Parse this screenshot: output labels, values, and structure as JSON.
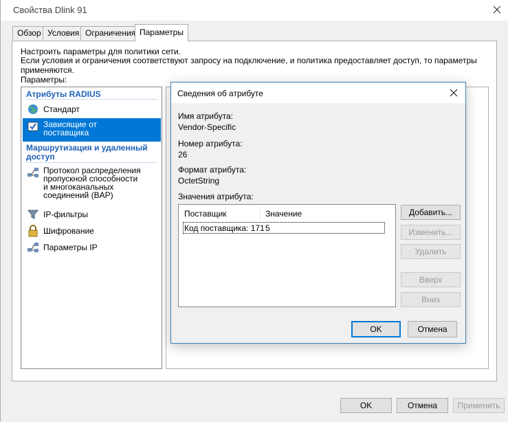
{
  "window": {
    "title": "Свойства Dlink 91",
    "tabs": [
      "Обзор",
      "Условия",
      "Ограничения",
      "Параметры"
    ],
    "description_line1": "Настроить параметры для политики сети.",
    "description_line2": "Если условия и ограничения соответствуют запросу на подключение, и политика предоставляет доступ, то параметры применяются.",
    "params_label": "Параметры:",
    "buttons": {
      "ok": "OK",
      "cancel": "Отмена",
      "apply": "Применить"
    }
  },
  "nav": {
    "radius_header": "Атрибуты RADIUS",
    "standard": "Стандарт",
    "vendor_line1": "Зависящие от",
    "vendor_line2": "поставщика",
    "routing_header_line1": "Маршрутизация и удаленный",
    "routing_header_line2": "доступ",
    "bap_line1": "Протокол распределения",
    "bap_line2": "пропускной способности",
    "bap_line3": "и многоканальных",
    "bap_line4": "соединений (BAP)",
    "ip_filters": "IP-фильтры",
    "encryption": "Шифрование",
    "ip_params": "Параметры IP"
  },
  "dialog": {
    "title": "Сведения об атрибуте",
    "attr_name_label": "Имя атрибута:",
    "attr_name_value": "Vendor-Specific",
    "attr_number_label": "Номер атрибута:",
    "attr_number_value": "26",
    "attr_format_label": "Формат атрибута:",
    "attr_format_value": "OctetString",
    "attr_values_label": "Значения атрибута:",
    "columns": {
      "vendor": "Поставщик",
      "value": "Значение"
    },
    "rows": [
      {
        "vendor": "Код поставщика: 171",
        "value": "5"
      }
    ],
    "buttons": {
      "add": "Добавить...",
      "edit": "Изменить...",
      "delete": "Удалить",
      "up": "Вверх",
      "down": "Вниз",
      "ok": "OK",
      "cancel": "Отмена"
    }
  },
  "colors": {
    "accent": "#0078d7",
    "nav_header": "#1e61b8"
  }
}
